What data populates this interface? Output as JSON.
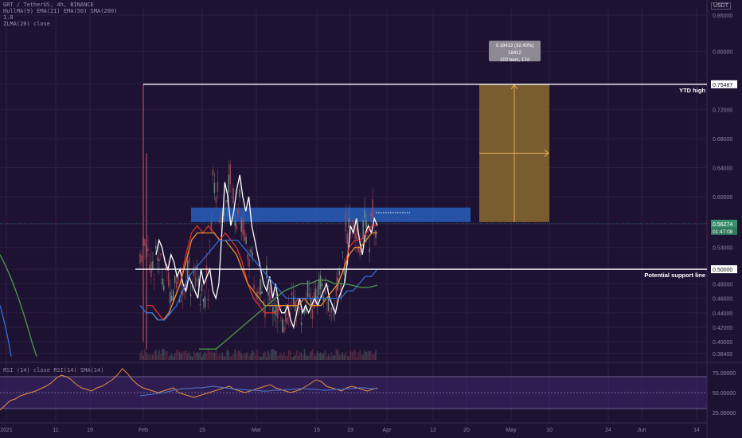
{
  "legend": {
    "pair_line": "GRT / TetherUS, 4h, BINANCE",
    "ma_line": "HullMA(9) EMA(21) EMA(50) SMA(200)",
    "line3": "1.0",
    "line4": "ZLMA(20) close"
  },
  "currency": "USDT",
  "rsi_legend": "RSI (14) close  RSI(14)  SMA(14)",
  "annotations": {
    "ytd_label": "YTD high",
    "support_label": "Potential support line",
    "measure_line1": "0.18412 (32.40%) 18412",
    "measure_line2": "102 bars, 17d"
  },
  "colors": {
    "background": "#1e1232",
    "up_candle": "#7a9a8a",
    "down_candle": "#b04a5a",
    "white_line": "#ffffff",
    "red_line": "#e0302a",
    "orange_line": "#e89030",
    "blue_line": "#2f6fd8",
    "green_line": "#4a9a4a",
    "zone_blue": "#2a6ad0",
    "zone_orange": "#8a6a30"
  },
  "chart_data": [
    {
      "type": "line",
      "title": "",
      "xlabel": "",
      "ylabel": "",
      "x_ticks": [
        "2021",
        "11",
        "19",
        "Feb",
        "15",
        "Mar",
        "15",
        "23",
        "Apr",
        "12",
        "20",
        "May",
        "10",
        "24",
        "Jun",
        "14"
      ],
      "y_ticks": [
        "0.85000",
        "0.80000",
        "0.75487",
        "0.72000",
        "0.68000",
        "0.64000",
        "0.60000",
        "0.56274",
        "0.53000",
        "0.50000",
        "0.48000",
        "0.46000",
        "0.44000",
        "0.42000",
        "0.40000",
        "0.38400"
      ],
      "ylim": [
        0.375,
        0.86
      ],
      "current_price": "0.56274",
      "countdown": "01:47:08",
      "ytd_high": 0.75487,
      "support_level": 0.5,
      "resistance_zone": [
        0.565,
        0.585
      ],
      "projection_box": {
        "low": 0.565,
        "high": 0.75487,
        "change": 0.18412,
        "change_pct": 32.4,
        "bars": 102,
        "days": 17
      },
      "series": [
        {
          "values": [
            0.52,
            0.54,
            0.53,
            0.51,
            0.5,
            0.52,
            0.51,
            0.49,
            0.5,
            0.48,
            0.47,
            0.49,
            0.48,
            0.47,
            0.46,
            0.5,
            0.48,
            0.49,
            0.5,
            0.47,
            0.46,
            0.48,
            0.55,
            0.62,
            0.6,
            0.56,
            0.58,
            0.61,
            0.63,
            0.6,
            0.58,
            0.6,
            0.56,
            0.54,
            0.52,
            0.5,
            0.48,
            0.47,
            0.49,
            0.46,
            0.48,
            0.45,
            0.44,
            0.44,
            0.45,
            0.43,
            0.42,
            0.44,
            0.46,
            0.44,
            0.45,
            0.44,
            0.45,
            0.46,
            0.45,
            0.46,
            0.47,
            0.48,
            0.46,
            0.45,
            0.44,
            0.46,
            0.47,
            0.48,
            0.51,
            0.56,
            0.55,
            0.57,
            0.54,
            0.52,
            0.55,
            0.56,
            0.55,
            0.57,
            0.56
          ]
        },
        {
          "values": [
            0.45,
            0.45,
            0.44,
            0.43,
            0.44,
            0.46,
            0.48,
            0.52,
            0.55,
            0.56,
            0.55,
            0.56,
            0.55,
            0.54,
            0.55,
            0.54,
            0.53,
            0.51,
            0.48,
            0.46,
            0.45,
            0.44,
            0.44,
            0.44,
            0.45,
            0.45,
            0.45,
            0.46,
            0.46,
            0.45,
            0.45,
            0.45,
            0.46,
            0.47,
            0.48,
            0.5,
            0.53,
            0.54,
            0.54,
            0.55,
            0.56,
            0.56
          ]
        },
        {
          "values": [
            0.44,
            0.44,
            0.43,
            0.43,
            0.44,
            0.46,
            0.48,
            0.51,
            0.54,
            0.55,
            0.55,
            0.55,
            0.55,
            0.54,
            0.54,
            0.53,
            0.52,
            0.5,
            0.48,
            0.47,
            0.46,
            0.45,
            0.45,
            0.45,
            0.45,
            0.45,
            0.45,
            0.45,
            0.46,
            0.45,
            0.45,
            0.45,
            0.46,
            0.47,
            0.48,
            0.5,
            0.52,
            0.53,
            0.53,
            0.54,
            0.55,
            0.55
          ]
        },
        {
          "values": [
            0.45,
            0.44,
            0.44,
            0.43,
            0.43,
            0.44,
            0.45,
            0.47,
            0.49,
            0.5,
            0.51,
            0.52,
            0.53,
            0.54,
            0.54,
            0.54,
            0.54,
            0.53,
            0.52,
            0.51,
            0.5,
            0.49,
            0.48,
            0.47,
            0.46,
            0.46,
            0.46,
            0.46,
            0.46,
            0.46,
            0.46,
            0.46,
            0.46,
            0.46,
            0.47,
            0.47,
            0.48,
            0.49,
            0.49,
            0.5
          ]
        },
        {
          "values": [
            0.39,
            0.39,
            0.39,
            0.4,
            0.41,
            0.42,
            0.43,
            0.44,
            0.45,
            0.46,
            0.47,
            0.475,
            0.48,
            0.48,
            0.485,
            0.485,
            0.48,
            0.48,
            0.478,
            0.475,
            0.475,
            0.478
          ]
        }
      ]
    },
    {
      "type": "line",
      "title": "",
      "xlabel": "",
      "ylabel": "",
      "y_ticks": [
        "75.00000",
        "50.00000",
        "25.00000"
      ],
      "ylim": [
        15,
        85
      ],
      "bands": [
        70,
        30
      ],
      "series": [
        {
          "values": [
            28,
            34,
            40,
            42,
            46,
            48,
            50,
            52,
            55,
            58,
            62,
            68,
            72,
            70,
            66,
            60,
            56,
            54,
            52,
            56,
            58,
            62,
            66,
            72,
            80,
            74,
            66,
            60,
            56,
            54,
            52,
            50,
            52,
            54,
            56,
            50,
            48,
            46,
            44,
            46,
            48,
            50,
            52,
            54,
            56,
            58,
            54,
            52,
            50,
            52,
            54,
            56,
            58,
            60,
            56,
            54,
            52,
            50,
            52,
            54,
            58,
            62,
            66,
            64,
            58,
            56,
            54,
            52,
            56,
            58,
            56,
            54,
            52,
            54,
            56
          ]
        },
        {
          "values": [
            46,
            47,
            48,
            49,
            50,
            52,
            54,
            55,
            55,
            56,
            56,
            57,
            58,
            57,
            56,
            55,
            54,
            54,
            53,
            53,
            52,
            52,
            53,
            53,
            54,
            54,
            55,
            55,
            54,
            54,
            53,
            53,
            54,
            54,
            55,
            55,
            56,
            56,
            55,
            55
          ]
        }
      ]
    }
  ]
}
